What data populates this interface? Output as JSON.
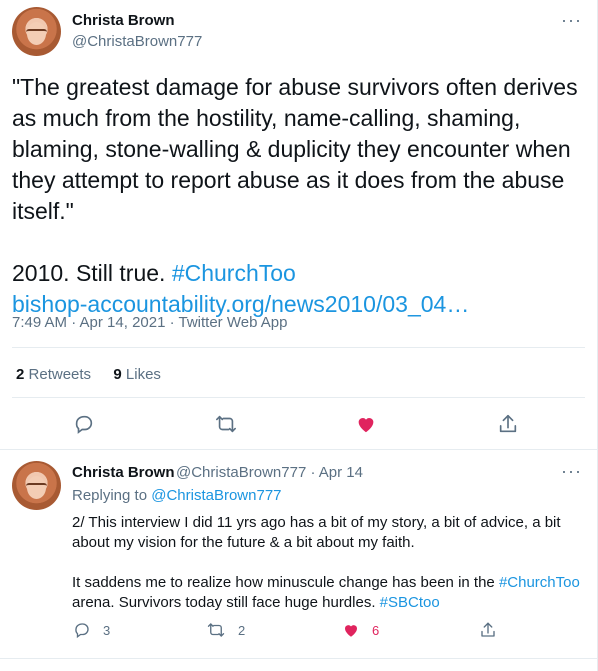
{
  "main_tweet": {
    "author_name": "Christa Brown",
    "author_handle": "@ChristaBrown777",
    "text_quote": "\"The greatest damage for abuse survivors often derives as much from the hostility, name-calling, shaming, blaming, stone-walling & duplicity they encounter when they attempt to report abuse as it does from the abuse itself.\"",
    "text_line2_prefix": "2010. Still true. ",
    "hashtag": "#ChurchToo",
    "link": "bishop-accountability.org/news2010/03_04…",
    "timestamp": "7:49 AM · Apr 14, 2021 · Twitter Web App",
    "retweets_count": "2",
    "retweets_label": "Retweets",
    "likes_count": "9",
    "likes_label": "Likes"
  },
  "reply_tweet": {
    "author_name": "Christa Brown",
    "author_handle_date": "@ChristaBrown777 · Apr 14",
    "replying_label": "Replying to ",
    "replying_handle": "@ChristaBrown777",
    "text_p1": "2/ This interview I did 11 yrs ago has a bit of my story, a bit of advice, a bit about my vision for the future & a bit about my faith.",
    "text_p2_prefix": "It saddens me to realize how minuscule change has been in the ",
    "text_p2_hashtag": "#ChurchToo",
    "text_p2_mid": " arena. Survivors today still face huge hurdles. ",
    "text_p2_hashtag2": "#SBCtoo",
    "reply_count": "3",
    "retweet_count": "2",
    "like_count": "6"
  },
  "icons": [
    "more-icon",
    "reply-icon",
    "retweet-icon",
    "like-icon",
    "share-icon"
  ],
  "colors": {
    "link": "#1b95e0",
    "like": "#e0245e",
    "muted": "#5b7083"
  }
}
